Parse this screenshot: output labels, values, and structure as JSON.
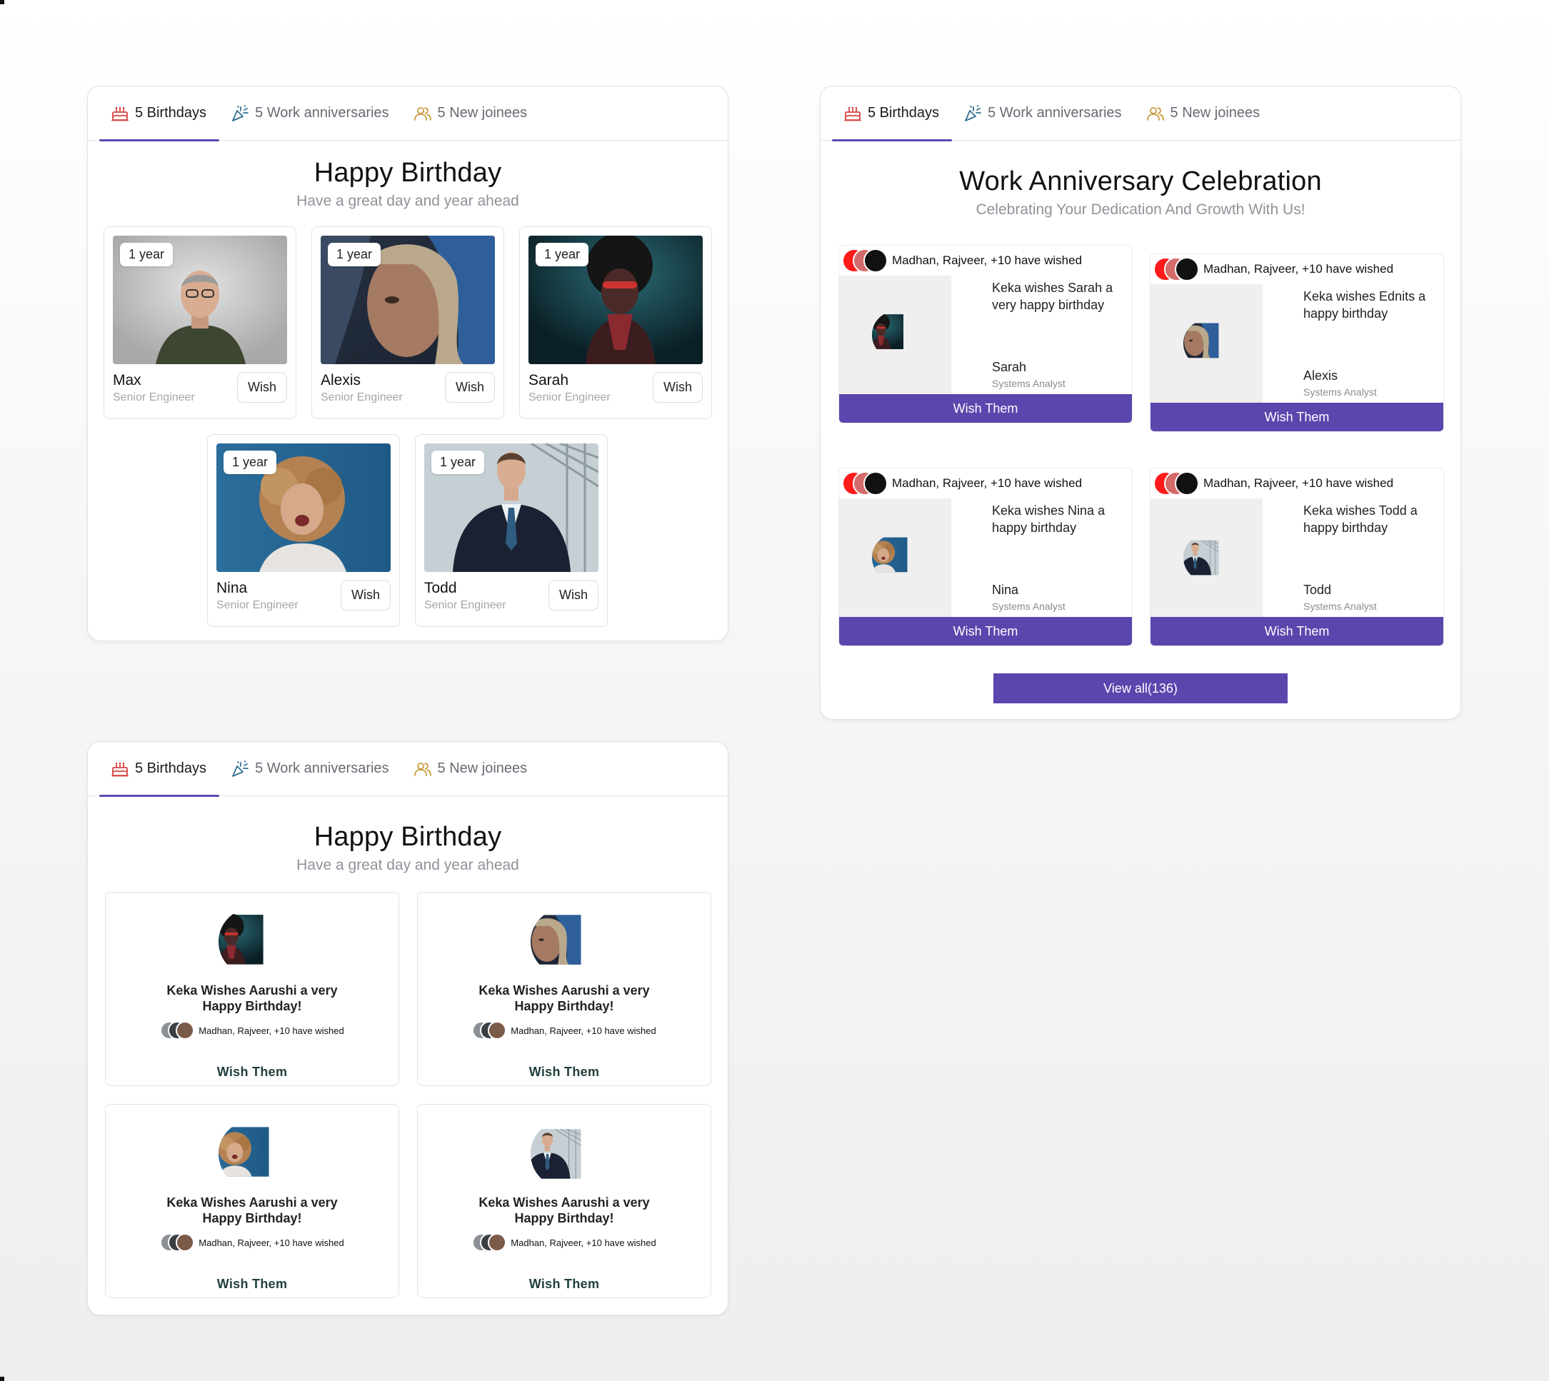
{
  "tabs": {
    "birthdays": "5 Birthdays",
    "anniversaries": "5 Work anniversaries",
    "joinees": "5 New joinees"
  },
  "birthday_panel": {
    "title": "Happy Birthday",
    "subtitle": "Have a great day and year ahead",
    "wish_label": "Wish",
    "people": [
      {
        "badge": "1 year",
        "name": "Max",
        "role": "Senior Engineer"
      },
      {
        "badge": "1 year",
        "name": "Alexis",
        "role": "Senior Engineer"
      },
      {
        "badge": "1 year",
        "name": "Sarah",
        "role": "Senior Engineer"
      },
      {
        "badge": "1 year",
        "name": "Nina",
        "role": "Senior Engineer"
      },
      {
        "badge": "1 year",
        "name": "Todd",
        "role": "Senior Engineer"
      }
    ]
  },
  "anniversary_panel": {
    "title": "Work Anniversary Celebration",
    "subtitle": "Celebrating Your Dedication And Growth With Us!",
    "button_label": "Wish Them",
    "view_all": "View all(136)",
    "cards": [
      {
        "wished": "Madhan, Rajveer, +10 have wished",
        "message": "Keka wishes Sarah a very happy birthday",
        "name": "Sarah",
        "role": "Systems Analyst"
      },
      {
        "wished": "Madhan, Rajveer, +10 have wished",
        "message": "Keka wishes Ednits a happy birthday",
        "name": "Alexis",
        "role": "Systems Analyst"
      },
      {
        "wished": "Madhan, Rajveer, +10 have wished",
        "message": "Keka wishes Nina a happy birthday",
        "name": "Nina",
        "role": "Systems Analyst"
      },
      {
        "wished": "Madhan, Rajveer, +10 have wished",
        "message": "Keka wishes Todd a happy birthday",
        "name": "Todd",
        "role": "Systems Analyst"
      }
    ]
  },
  "wish_panel": {
    "title": "Happy Birthday",
    "subtitle": "Have a great day and year ahead",
    "button_label": "Wish Them",
    "cards": [
      {
        "message": "Keka Wishes Aarushi a very Happy Birthday!",
        "wished": "Madhan, Rajveer, +10 have wished"
      },
      {
        "message": "Keka Wishes Aarushi a very Happy Birthday!",
        "wished": "Madhan, Rajveer, +10 have wished"
      },
      {
        "message": "Keka Wishes Aarushi a very Happy Birthday!",
        "wished": "Madhan, Rajveer, +10 have wished"
      },
      {
        "message": "Keka Wishes Aarushi a very Happy Birthday!",
        "wished": "Madhan, Rajveer, +10 have wished"
      }
    ]
  },
  "colors": {
    "accent": "#5a46ad",
    "tab_underline": "#5a4bb0",
    "cake_icon": "#d64545",
    "party_icon": "#2f6f8f",
    "people_icon": "#c99a3c"
  },
  "icons": [
    "cake-icon",
    "party-popper-icon",
    "people-icon"
  ]
}
